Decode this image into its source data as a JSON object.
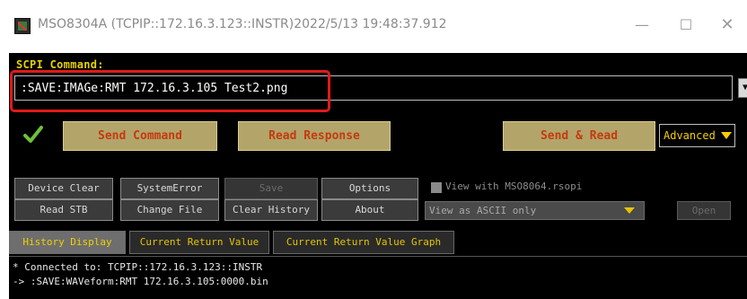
{
  "window": {
    "title": "MSO8304A (TCPIP::172.16.3.123::INSTR)2022/5/13 19:48:37.912",
    "icon": "app-icon",
    "controls": {
      "minimize": "—",
      "maximize": "☐",
      "close": "✕"
    }
  },
  "scpi": {
    "label": "SCPI Command:",
    "command_value": ":SAVE:IMAGe:RMT 172.16.3.105 Test2.png",
    "dropdown_arrow": "▼"
  },
  "toolbar": {
    "check_icon": "check-icon",
    "send_command": "Send Command",
    "read_response": "Read Response",
    "send_and_read": "Send & Read",
    "advanced": "Advanced"
  },
  "buttons": {
    "device_clear": "Device Clear",
    "system_error": "SystemError",
    "save": "Save",
    "options": "Options",
    "read_stb": "Read STB",
    "change_file": "Change File",
    "clear_history": "Clear History",
    "about": "About",
    "open": "Open"
  },
  "options": {
    "view_with_label": "View with MSO8064.rsopi",
    "view_as": "View as ASCII only"
  },
  "tabs": [
    {
      "label": "History Display",
      "active": true
    },
    {
      "label": "Current Return Value",
      "active": false
    },
    {
      "label": "Current Return Value Graph",
      "active": false
    }
  ],
  "console": {
    "lines": [
      "* Connected to: TCPIP::172.16.3.123::INSTR",
      "-> :SAVE:WAVeform:RMT 172.16.3.105:0000.bin"
    ]
  },
  "colors": {
    "accent_yellow": "#e6d200",
    "button_olive": "#b3a569",
    "button_text": "#c43a10",
    "highlight_red": "#e11a1a",
    "check_green": "#6cc13a"
  }
}
